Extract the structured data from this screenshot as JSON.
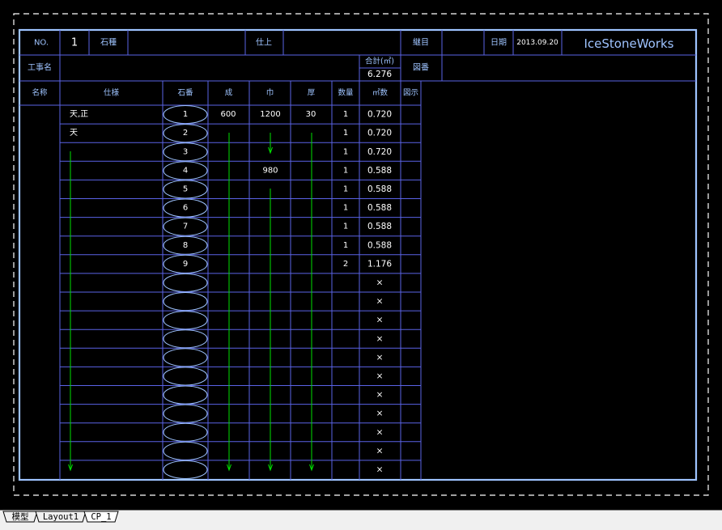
{
  "header": {
    "no_label": "NO.",
    "no_value": "1",
    "stone_label": "石種",
    "stone_value": "",
    "finish_label": "仕上",
    "finish_value": "",
    "joint_label": "継目",
    "joint_value": "",
    "date_label": "日期",
    "date_value": "2013.09.20",
    "brand": "IceStoneWorks",
    "project_label": "工事名",
    "project_value": "",
    "total_label": "合計(㎡)",
    "total_value": "6.276",
    "drawing_no_label": "図番",
    "drawing_no_value": ""
  },
  "columns": [
    "名称",
    "仕様",
    "石番",
    "成",
    "巾",
    "厚",
    "数量",
    "㎡数",
    "図示"
  ],
  "rows": [
    {
      "spec": "天,正",
      "no": "1",
      "h": "600",
      "w": "1200",
      "t": "30",
      "qty": "1",
      "area": "0.720"
    },
    {
      "spec": "天",
      "no": "2",
      "h": "",
      "w": "",
      "t": "",
      "qty": "1",
      "area": "0.720"
    },
    {
      "spec": "",
      "no": "3",
      "h": "",
      "w": "",
      "t": "",
      "qty": "1",
      "area": "0.720"
    },
    {
      "spec": "",
      "no": "4",
      "h": "",
      "w": "980",
      "t": "",
      "qty": "1",
      "area": "0.588"
    },
    {
      "spec": "",
      "no": "5",
      "h": "",
      "w": "",
      "t": "",
      "qty": "1",
      "area": "0.588"
    },
    {
      "spec": "",
      "no": "6",
      "h": "",
      "w": "",
      "t": "",
      "qty": "1",
      "area": "0.588"
    },
    {
      "spec": "",
      "no": "7",
      "h": "",
      "w": "",
      "t": "",
      "qty": "1",
      "area": "0.588"
    },
    {
      "spec": "",
      "no": "8",
      "h": "",
      "w": "",
      "t": "",
      "qty": "1",
      "area": "0.588"
    },
    {
      "spec": "",
      "no": "9",
      "h": "",
      "w": "",
      "t": "",
      "qty": "2",
      "area": "1.176"
    },
    {
      "spec": "",
      "no": "",
      "h": "",
      "w": "",
      "t": "",
      "qty": "",
      "area": "×"
    },
    {
      "spec": "",
      "no": "",
      "h": "",
      "w": "",
      "t": "",
      "qty": "",
      "area": "×"
    },
    {
      "spec": "",
      "no": "",
      "h": "",
      "w": "",
      "t": "",
      "qty": "",
      "area": "×"
    },
    {
      "spec": "",
      "no": "",
      "h": "",
      "w": "",
      "t": "",
      "qty": "",
      "area": "×"
    },
    {
      "spec": "",
      "no": "",
      "h": "",
      "w": "",
      "t": "",
      "qty": "",
      "area": "×"
    },
    {
      "spec": "",
      "no": "",
      "h": "",
      "w": "",
      "t": "",
      "qty": "",
      "area": "×"
    },
    {
      "spec": "",
      "no": "",
      "h": "",
      "w": "",
      "t": "",
      "qty": "",
      "area": "×"
    },
    {
      "spec": "",
      "no": "",
      "h": "",
      "w": "",
      "t": "",
      "qty": "",
      "area": "×"
    },
    {
      "spec": "",
      "no": "",
      "h": "",
      "w": "",
      "t": "",
      "qty": "",
      "area": "×"
    },
    {
      "spec": "",
      "no": "",
      "h": "",
      "w": "",
      "t": "",
      "qty": "",
      "area": "×"
    },
    {
      "spec": "",
      "no": "",
      "h": "",
      "w": "",
      "t": "",
      "qty": "",
      "area": "×"
    }
  ],
  "tabs": [
    {
      "label": "模型",
      "active": false
    },
    {
      "label": "Layout1",
      "active": false
    },
    {
      "label": "CP_1",
      "active": true
    }
  ],
  "colors": {
    "background": "#000000",
    "outer_frame": "#9ec3ff",
    "grid": "#5a63e6",
    "label_text": "#9ec3ff",
    "value_text": "#ffffff",
    "ditto_arrow": "#00e000",
    "dash_border": "#ffffff"
  }
}
